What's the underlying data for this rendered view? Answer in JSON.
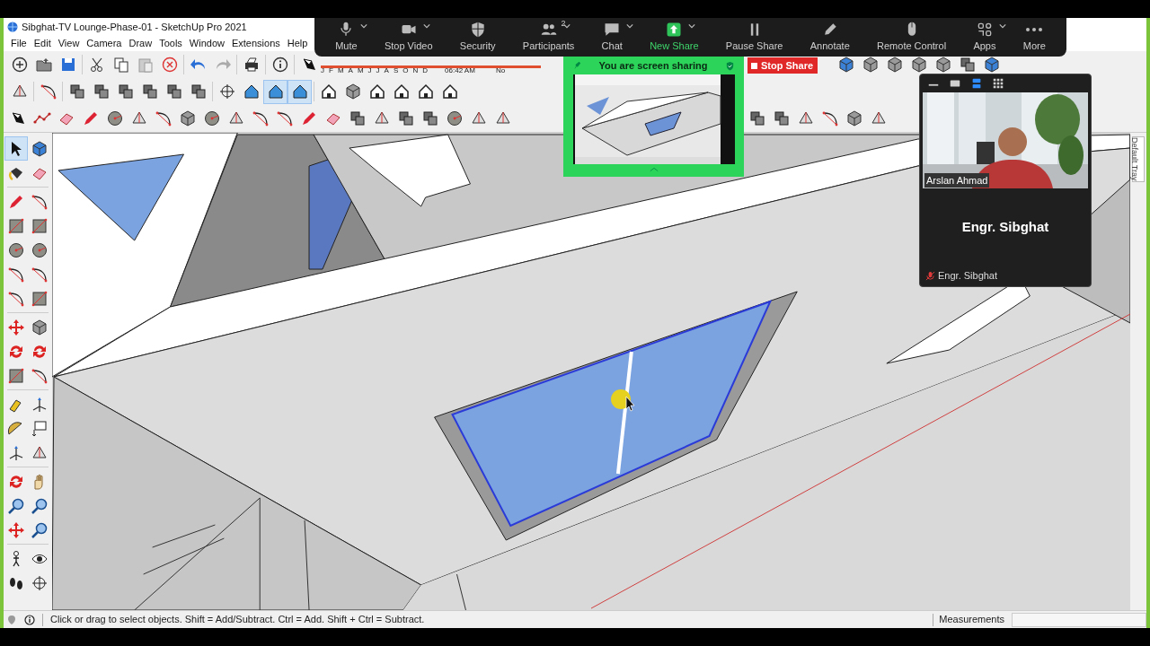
{
  "window": {
    "title": "Sibghat-TV Lounge-Phase-01 - SketchUp Pro 2021"
  },
  "menu": [
    {
      "label": "File"
    },
    {
      "label": "Edit"
    },
    {
      "label": "View"
    },
    {
      "label": "Camera"
    },
    {
      "label": "Draw"
    },
    {
      "label": "Tools"
    },
    {
      "label": "Window"
    },
    {
      "label": "Extensions"
    },
    {
      "label": "Help"
    }
  ],
  "shadow_bar": {
    "months": [
      "J",
      "F",
      "M",
      "A",
      "M",
      "J",
      "J",
      "A",
      "S",
      "O",
      "N",
      "D"
    ],
    "time": "06:42 AM",
    "noon": "No"
  },
  "meeting_controls": [
    {
      "kind": "mic",
      "label": "Mute",
      "caret": true,
      "highlight": false
    },
    {
      "kind": "camera",
      "label": "Stop Video",
      "caret": true,
      "highlight": false
    },
    {
      "kind": "shield",
      "label": "Security",
      "caret": false,
      "highlight": false
    },
    {
      "kind": "people",
      "label": "Participants",
      "badge": "2",
      "caret": true,
      "highlight": false
    },
    {
      "kind": "chat",
      "label": "Chat",
      "caret": true,
      "highlight": false
    },
    {
      "kind": "share",
      "label": "New Share",
      "caret": true,
      "highlight": true
    },
    {
      "kind": "pause",
      "label": "Pause Share",
      "caret": false,
      "highlight": false
    },
    {
      "kind": "pen",
      "label": "Annotate",
      "caret": false,
      "highlight": false
    },
    {
      "kind": "mouse",
      "label": "Remote Control",
      "caret": false,
      "highlight": false
    },
    {
      "kind": "apps",
      "label": "Apps",
      "caret": true,
      "highlight": false
    },
    {
      "kind": "more",
      "label": "More",
      "caret": false,
      "highlight": false
    }
  ],
  "share_banner": {
    "label": "You are screen sharing",
    "stop_button": "Stop Share"
  },
  "video_panel": {
    "layouts": [
      {
        "kind": "minimize",
        "selected": false
      },
      {
        "kind": "single",
        "selected": false
      },
      {
        "kind": "speaker",
        "selected": true
      },
      {
        "kind": "gallery",
        "selected": false
      }
    ],
    "tiles": [
      {
        "kind": "video",
        "name": "Arslan Ahmad"
      },
      {
        "kind": "avatar",
        "display_name": "Engr. Sibghat",
        "name": "Engr. Sibghat",
        "muted": true
      }
    ]
  },
  "tray": {
    "label": "Default Tray"
  },
  "status_bar": {
    "hint": "Click or drag to select objects. Shift = Add/Subtract. Ctrl = Add. Shift + Ctrl = Subtract.",
    "measurements_label": "Measurements"
  }
}
